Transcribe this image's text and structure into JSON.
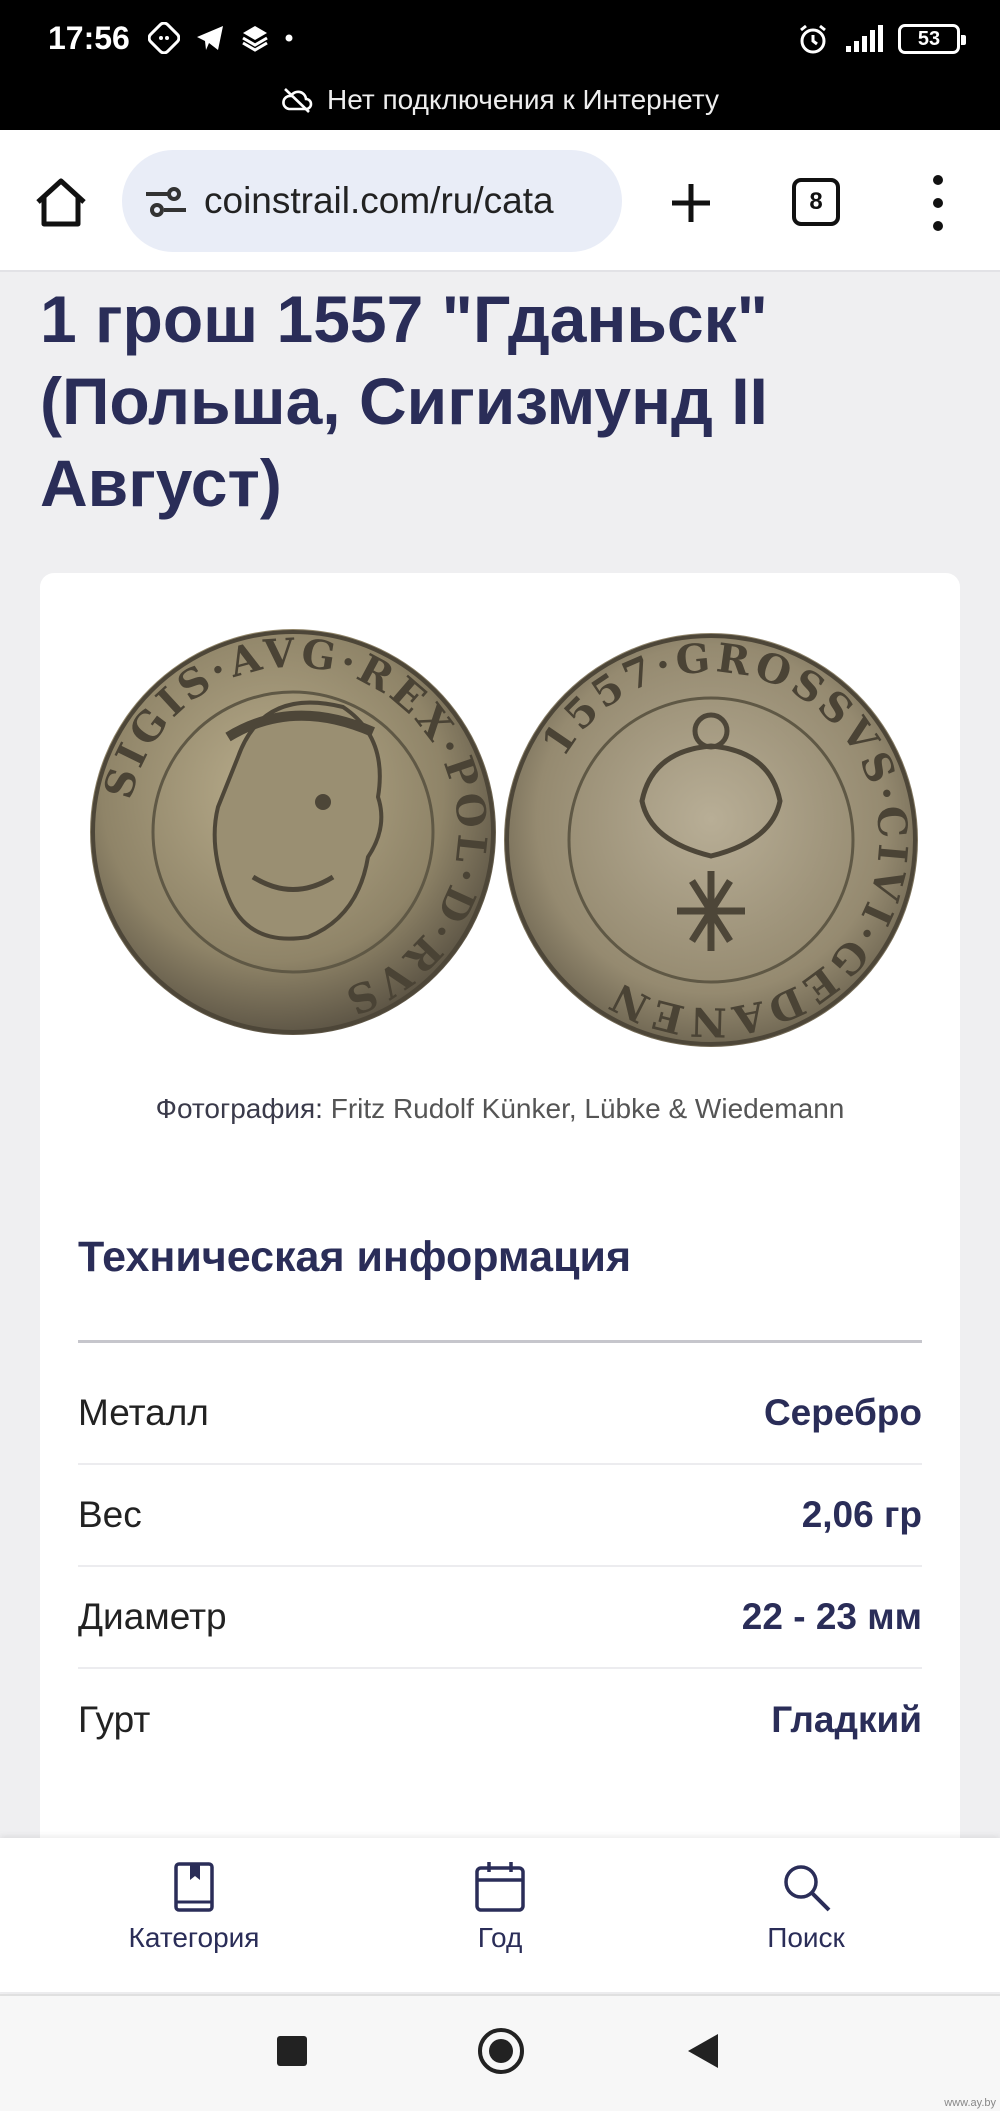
{
  "status_bar": {
    "time": "17:56",
    "battery": "53",
    "offline_text": "Нет подключения к Интернету"
  },
  "browser": {
    "url": "coinstrail.com/ru/cata",
    "tab_count": "8"
  },
  "page": {
    "title": "1 грош 1557 \"Гданьск\" (Польша, Сигизмунд II Август)",
    "coin_images": [
      {
        "name": "obverse",
        "legend": "SIGIS·AVG·REX·POL·D·RVS"
      },
      {
        "name": "reverse",
        "legend": "1557·GROSSVS·CIVI·GEDANEN"
      }
    ],
    "photo_caption_label": "Фотография:",
    "photo_caption_credit": "Fritz Rudolf Künker, Lübke & Wiedemann",
    "tech_section_title": "Техническая информация",
    "specs": [
      {
        "key": "Металл",
        "value": "Серебро"
      },
      {
        "key": "Вес",
        "value": "2,06 гр"
      },
      {
        "key": "Диаметр",
        "value": "22 - 23 мм"
      },
      {
        "key": "Гурт",
        "value": "Гладкий"
      }
    ]
  },
  "bottom_nav": [
    {
      "label": "Категория",
      "icon": "book-icon"
    },
    {
      "label": "Год",
      "icon": "calendar-icon"
    },
    {
      "label": "Поиск",
      "icon": "search-icon"
    }
  ],
  "watermark": "www.ay.by",
  "colors": {
    "heading": "#2a2d58",
    "background": "#efeff1",
    "url_bar": "#e9edf7"
  }
}
